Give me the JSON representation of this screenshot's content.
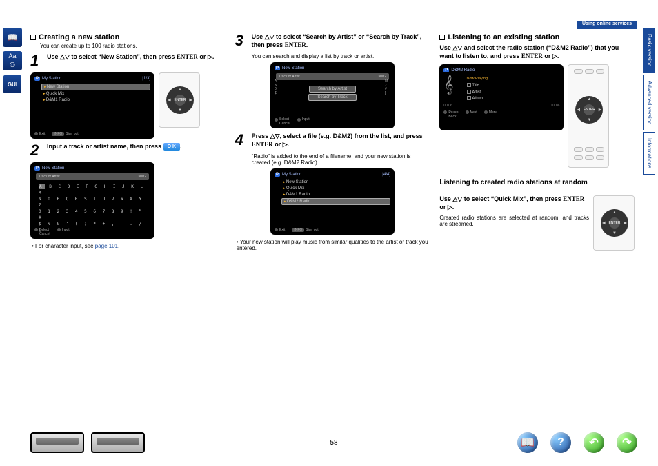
{
  "header": {
    "breadcrumb": "Using online services"
  },
  "tabs": {
    "basic": "Basic version",
    "advanced": "Advanced version",
    "info": "Informations"
  },
  "col1": {
    "title": "Creating a new station",
    "sub": "You can create up to 100 radio stations.",
    "step1": {
      "num": "1",
      "text_a": "Use ",
      "text_b": " to select “New Station”, then press ",
      "enter": "ENTER",
      "text_c": " or ",
      "text_d": "."
    },
    "screen1": {
      "title": "My Station",
      "count": "[1/3]",
      "items": [
        "New Station",
        "Quick Mix",
        "D&M1 Radio"
      ],
      "f_exit": "Exit",
      "f_sign": "Sign out"
    },
    "step2": {
      "num": "2",
      "text_a": "Input a track or artist name, then press ",
      "ok": "O K",
      "text_b": "."
    },
    "screen2": {
      "title": "New Station",
      "bar_l": "Track or Artist",
      "bar_r": "D&M2",
      "row1": "A B C D E F G H I J K L M",
      "row2": "N O P Q R S T U V W X Y Z",
      "row3": "0 1 2 3 4 5 6 7 8 9 ! “ #",
      "row4": "$ % & ‘ ( ) * + , - . / [",
      "f_sel": "Select",
      "f_can": "Cancel",
      "f_inp": "Input"
    },
    "bullet": {
      "a": "For character input, see ",
      "link": "page 101",
      "b": "."
    }
  },
  "col2": {
    "step3": {
      "num": "3",
      "text_a": "Use ",
      "text_b": " to select “Search by Artist” or “Search by Track”, then press ",
      "enter": "ENTER",
      "text_c": "."
    },
    "note3": "You can search and display a list by track or artist.",
    "screen3": {
      "title": "New Station",
      "bar_l": "Track or Artist",
      "bar_r": "D&M2",
      "opt1": "Search by Artist",
      "opt2": "Search by Track",
      "left_side": "A\nN\n0\n$",
      "right_side": "M\nZ\n#\n[",
      "f_sel": "Select",
      "f_can": "Cancel",
      "f_inp": "Input"
    },
    "step4": {
      "num": "4",
      "text_a": "Press ",
      "text_b": ", select a file (e.g. D&M2) from the list, and press ",
      "enter": "ENTER",
      "text_c": " or ",
      "text_d": "."
    },
    "note4": "“Radio” is added to the end of a filename, and your new station is created (e.g. D&M2 Radio).",
    "screen4": {
      "title": "My Station",
      "count": "[4/4]",
      "items": [
        "New Station",
        "Quick Mix",
        "D&M1 Radio",
        "D&M2 Radio"
      ],
      "f_exit": "Exit",
      "f_sign": "Sign out"
    },
    "bullet2": "Your new station will play music from similar qualities to the artist or track you entered."
  },
  "col3": {
    "title": "Listening to an existing station",
    "step_a": {
      "text_a": "Use ",
      "text_b": " and select the radio station (“D&M2 Radio”) that you want to listen to, and press ",
      "enter": "ENTER",
      "text_c": " or ",
      "text_d": "."
    },
    "player": {
      "title": "D&M2 Radio",
      "np": "Now Playing",
      "m1": "Title",
      "m2": "Artist",
      "m3": "Album",
      "t1": "00:06",
      "t2": "100%",
      "pf1": "Pause",
      "pf1b": "Back",
      "pf2": "Next",
      "pf3": "Menu"
    },
    "sub_heading": "Listening to created radio stations at random",
    "step_b": {
      "text_a": "Use ",
      "text_b": " to select “Quick Mix”, then press ",
      "enter": "ENTER",
      "text_c": " or ",
      "text_d": "."
    },
    "note_b": "Created radio stations are selected at random, and tracks are streamed."
  },
  "footer": {
    "page": "58"
  }
}
